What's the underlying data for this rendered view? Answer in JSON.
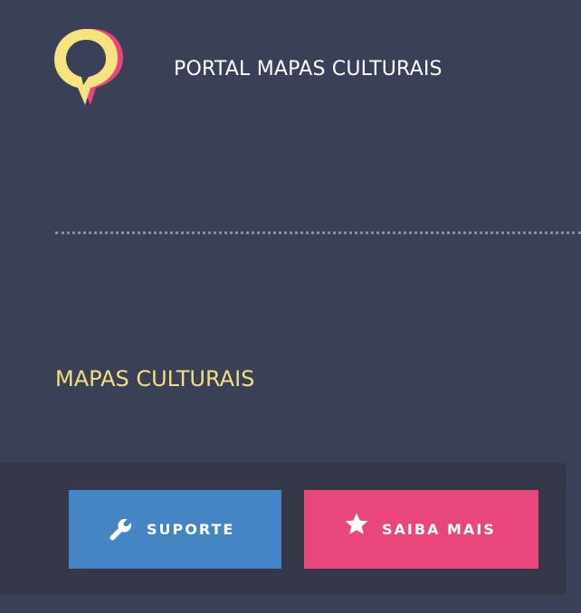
{
  "header": {
    "portal_title": "PORTAL MAPAS CULTURAIS",
    "logo_icon": "map-pin-chat-icon"
  },
  "main": {
    "section_title": "MAPAS CULTURAIS"
  },
  "footer": {
    "buttons": [
      {
        "label": "SUPORTE",
        "icon": "wrench-icon",
        "color": "#4585c4"
      },
      {
        "label": "SAIBA MAIS",
        "icon": "star-icon",
        "color": "#e9477c"
      }
    ]
  },
  "colors": {
    "background": "#3b4059",
    "footer_background": "#343849",
    "accent_yellow": "#f3df7c",
    "accent_pink": "#e9477c",
    "accent_blue": "#4585c4"
  }
}
